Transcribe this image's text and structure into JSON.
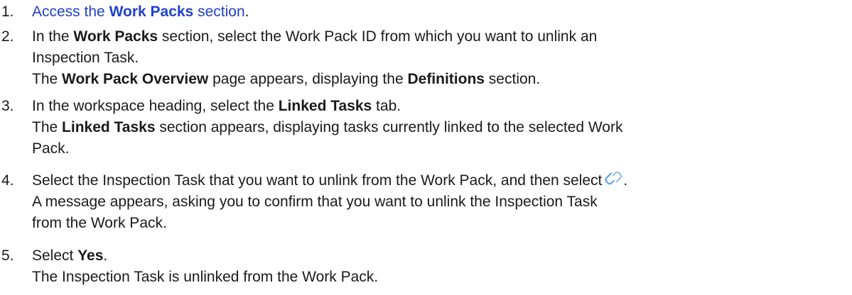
{
  "steps": [
    {
      "number": "1.",
      "text_a": "Access the ",
      "bold_a": "Work Packs",
      "text_b": " section",
      "end": "."
    },
    {
      "number": "2.",
      "text_a": "In the ",
      "bold_a": "Work Packs",
      "text_b": " section, select the Work Pack ID from which you want to unlink an",
      "text_c": "Inspection Task.",
      "result_a": "The ",
      "result_bold_a": "Work Pack Overview",
      "result_b": " page appears, displaying the ",
      "result_bold_b": "Definitions",
      "result_c": " section."
    },
    {
      "number": "3.",
      "text_a": "In the workspace heading, select the ",
      "bold_a": "Linked Tasks",
      "text_b": " tab.",
      "result_a": "The ",
      "result_bold_a": "Linked Tasks",
      "result_b": " section appears, displaying tasks currently linked to the selected Work",
      "result_c": "Pack."
    },
    {
      "number": "4.",
      "text_a": "Select the Inspection Task that you want to unlink from the Work Pack, and then select",
      "icon": "unlink-icon",
      "text_b": ".",
      "result_a": "A message appears, asking you to confirm that you want to unlink the Inspection Task",
      "result_b": "from the Work Pack."
    },
    {
      "number": "5.",
      "text_a": "Select ",
      "bold_a": "Yes",
      "text_b": ".",
      "result_a": "The Inspection Task is unlinked from the Work Pack."
    }
  ],
  "colors": {
    "link": "#1f3fd1",
    "text": "#1a1a1a",
    "icon_left": "#5aa0e6",
    "icon_right": "#8ec3ef"
  }
}
